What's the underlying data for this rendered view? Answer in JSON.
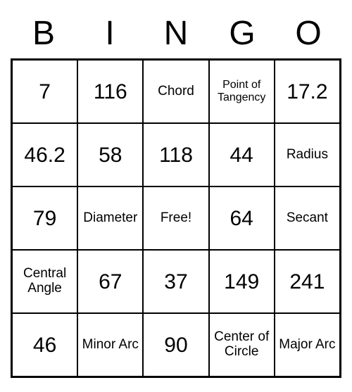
{
  "headers": [
    "B",
    "I",
    "N",
    "G",
    "O"
  ],
  "cells": [
    {
      "text": "7",
      "size": "normal"
    },
    {
      "text": "116",
      "size": "normal"
    },
    {
      "text": "Chord",
      "size": "small"
    },
    {
      "text": "Point of Tangency",
      "size": "xsmall"
    },
    {
      "text": "17.2",
      "size": "normal"
    },
    {
      "text": "46.2",
      "size": "normal"
    },
    {
      "text": "58",
      "size": "normal"
    },
    {
      "text": "118",
      "size": "normal"
    },
    {
      "text": "44",
      "size": "normal"
    },
    {
      "text": "Radius",
      "size": "small"
    },
    {
      "text": "79",
      "size": "normal"
    },
    {
      "text": "Diameter",
      "size": "small"
    },
    {
      "text": "Free!",
      "size": "small"
    },
    {
      "text": "64",
      "size": "normal"
    },
    {
      "text": "Secant",
      "size": "small"
    },
    {
      "text": "Central Angle",
      "size": "small"
    },
    {
      "text": "67",
      "size": "normal"
    },
    {
      "text": "37",
      "size": "normal"
    },
    {
      "text": "149",
      "size": "normal"
    },
    {
      "text": "241",
      "size": "normal"
    },
    {
      "text": "46",
      "size": "normal"
    },
    {
      "text": "Minor Arc",
      "size": "small"
    },
    {
      "text": "90",
      "size": "normal"
    },
    {
      "text": "Center of Circle",
      "size": "small"
    },
    {
      "text": "Major Arc",
      "size": "small"
    }
  ]
}
